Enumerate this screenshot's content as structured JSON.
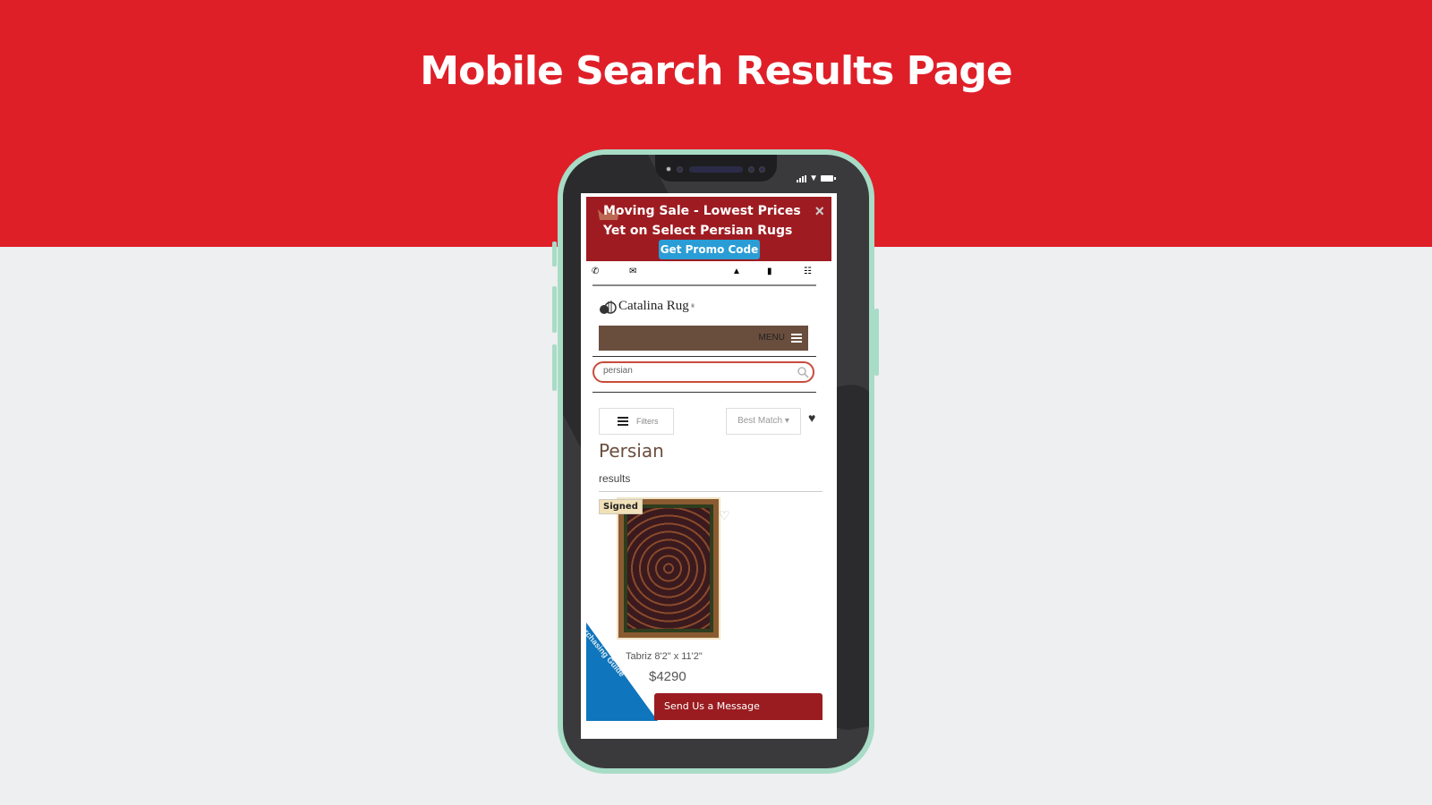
{
  "slide": {
    "title": "Mobile Search Results Page",
    "colors": {
      "band": "#df1f28",
      "background": "#eeeff0",
      "phone_frame": "#a8dcc7"
    }
  },
  "screen": {
    "promo": {
      "text": "Moving Sale - Lowest Prices Yet on Select Persian Rugs",
      "button": "Get Promo Code",
      "close": "×",
      "colors": {
        "bg": "#9e1c21",
        "button": "#2a9dd6"
      }
    },
    "top_icons": [
      "phone-icon",
      "envelope-icon",
      "user-icon",
      "bookmark-icon",
      "cart-icon"
    ],
    "brand": {
      "name": "Catalina Rug",
      "mark": "®"
    },
    "menu": {
      "label": "MENU",
      "color": "#6a4e3d"
    },
    "search": {
      "value": "persian",
      "placeholder": ""
    },
    "toolbar": {
      "filters": "Filters",
      "sort": "Best Match ▾"
    },
    "results": {
      "title": "Persian",
      "subtitle": "results",
      "items": [
        {
          "badge": "Signed",
          "name": "Tabriz 8'2\" x 11'2\"",
          "price": "$4290"
        }
      ]
    },
    "guide_banner": {
      "text": "Free Rug Purchasing Guide",
      "color": "#0f75bc"
    },
    "message_button": {
      "label": "Send Us a Message",
      "color": "#9a1c20"
    }
  }
}
